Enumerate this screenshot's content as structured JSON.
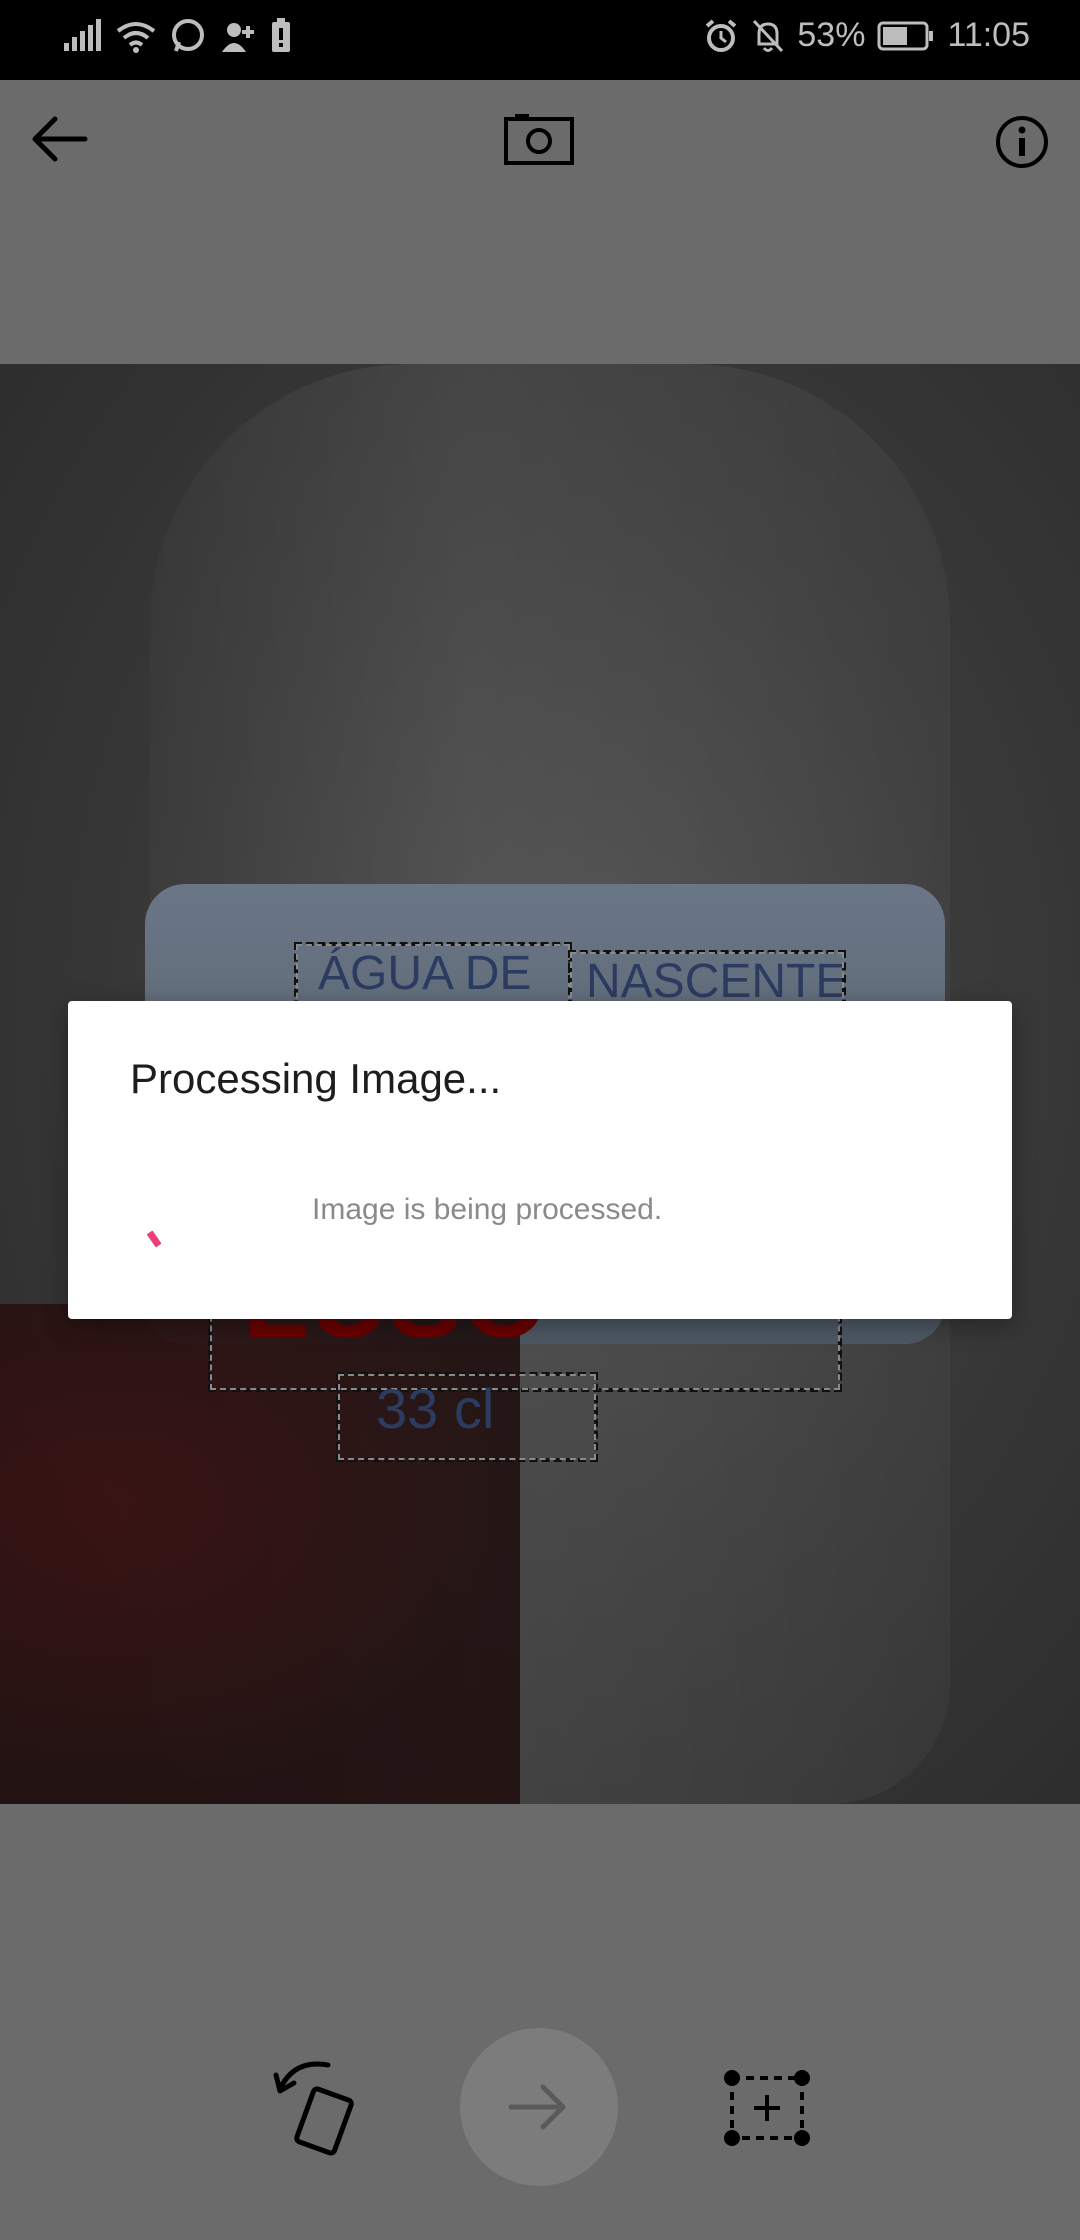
{
  "status_bar": {
    "battery_percent": "53%",
    "time": "11:05",
    "left_icons": [
      "signal-icon",
      "wifi-icon",
      "whatsapp-icon",
      "add-contact-icon",
      "battery-alert-icon"
    ],
    "right_icons": [
      "alarm-icon",
      "notifications-off-icon",
      "battery-icon"
    ]
  },
  "toolbar": {
    "back_icon": "arrow-left-icon",
    "camera_icon": "camera-icon",
    "info_icon": "info-icon"
  },
  "photo": {
    "detected_regions": [
      {
        "text": "ÁGUA DE"
      },
      {
        "text": "NASCENTE"
      },
      {
        "text": "LUSO"
      },
      {
        "text": "33 cl"
      }
    ]
  },
  "dialog": {
    "title": "Processing Image...",
    "message": "Image is being processed.",
    "spinner_color": "#e8407a"
  },
  "bottom_bar": {
    "rotate_icon": "rotate-icon",
    "next_icon": "arrow-right-icon",
    "add_region_icon": "add-region-icon"
  },
  "colors": {
    "scrim": "#6b6b6b",
    "accent": "#e8407a"
  }
}
